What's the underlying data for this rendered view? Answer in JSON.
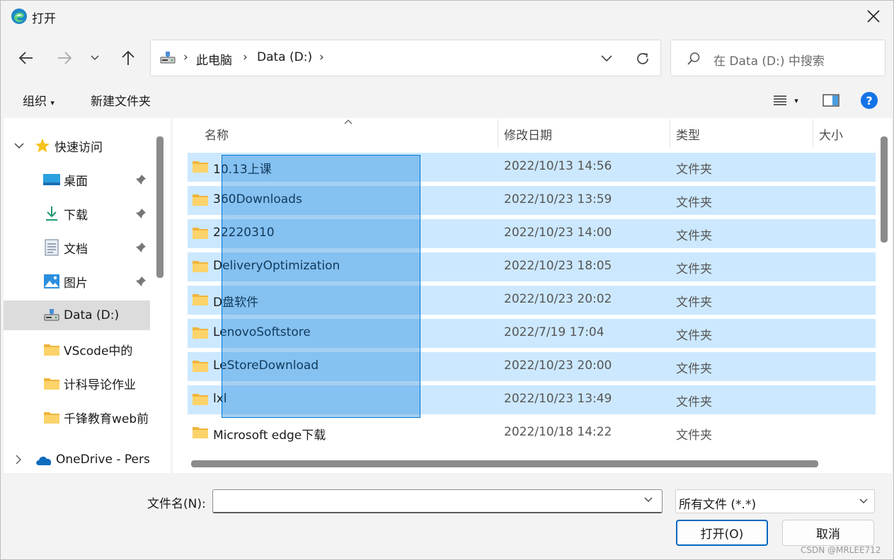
{
  "window": {
    "title": "打开"
  },
  "address": {
    "crumbs": [
      "此电脑",
      "Data (D:)"
    ]
  },
  "search": {
    "placeholder": "在 Data (D:) 中搜索"
  },
  "commands": {
    "organize": "组织",
    "new_folder": "新建文件夹"
  },
  "sidebar": {
    "items": [
      {
        "label": "快速访问",
        "icon": "star-icon"
      },
      {
        "label": "桌面",
        "icon": "desktop-icon"
      },
      {
        "label": "下载",
        "icon": "download-icon"
      },
      {
        "label": "文档",
        "icon": "document-icon"
      },
      {
        "label": "图片",
        "icon": "picture-icon"
      },
      {
        "label": "Data (D:)",
        "icon": "drive-icon"
      },
      {
        "label": "VScode中的",
        "icon": "folder-icon"
      },
      {
        "label": "计科导论作业",
        "icon": "folder-icon"
      },
      {
        "label": "千锋教育web前",
        "icon": "folder-icon"
      },
      {
        "label": "OneDrive - Pers",
        "icon": "cloud-icon"
      }
    ]
  },
  "columns": {
    "name": "名称",
    "date": "修改日期",
    "type": "类型",
    "size": "大小"
  },
  "files": [
    {
      "name": "10.13上课",
      "date": "2022/10/13 14:56",
      "type": "文件夹"
    },
    {
      "name": "360Downloads",
      "date": "2022/10/23 13:59",
      "type": "文件夹"
    },
    {
      "name": "22220310",
      "date": "2022/10/23 14:00",
      "type": "文件夹"
    },
    {
      "name": "DeliveryOptimization",
      "date": "2022/10/23 18:05",
      "type": "文件夹"
    },
    {
      "name": "D盘软件",
      "date": "2022/10/23 20:02",
      "type": "文件夹"
    },
    {
      "name": "LenovoSoftstore",
      "date": "2022/7/19 17:04",
      "type": "文件夹"
    },
    {
      "name": "LeStoreDownload",
      "date": "2022/10/23 20:00",
      "type": "文件夹"
    },
    {
      "name": "lxl",
      "date": "2022/10/23 13:49",
      "type": "文件夹"
    },
    {
      "name": "Microsoft edge下载",
      "date": "2022/10/18 14:22",
      "type": "文件夹"
    }
  ],
  "bottom": {
    "filename_label": "文件名(N):",
    "filename_value": "",
    "filetype": "所有文件 (*.*)",
    "open_label": "打开(O)",
    "cancel_label": "取消"
  },
  "watermark": "CSDN @MRLEE712",
  "colors": {
    "accent": "#0067c0",
    "selection": "#cce8ff",
    "folder": "#f8c44f"
  }
}
